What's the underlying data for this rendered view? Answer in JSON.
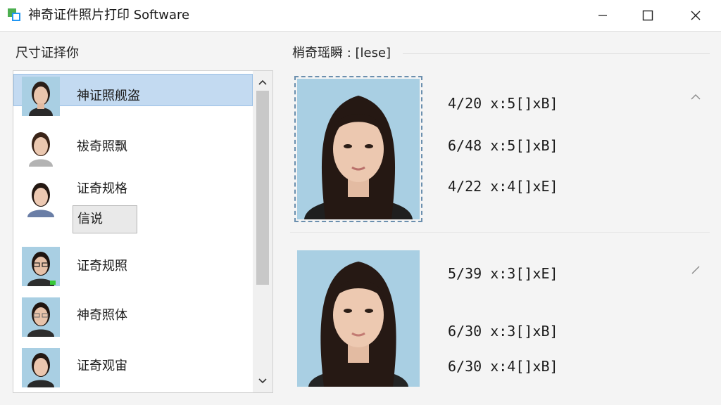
{
  "window": {
    "title": "神奇证件照片打印 Software"
  },
  "left_panel": {
    "title": "尺寸证择你",
    "items": [
      {
        "label": "神证照舰盗"
      },
      {
        "label": "祓奇照飘"
      },
      {
        "label": "证奇规格"
      },
      {
        "label": "证奇规照"
      },
      {
        "label": "神奇照体"
      },
      {
        "label": "证奇观宙"
      }
    ],
    "tooltip": "信说"
  },
  "right_panel": {
    "title": "梢奇瑶瞬 : [lese]",
    "groups": [
      {
        "sizes": [
          "4/20 x:5[]xB]",
          "6/48 x:5[]xB]",
          "4/22 x:4[]xE]"
        ]
      },
      {
        "sizes": [
          "5/39 x:3[]xE]",
          "6/30 x:3[]xB]",
          "6/30 x:4[]xB]"
        ]
      }
    ]
  },
  "colors": {
    "photo_background": "#a9cfe3",
    "selection": "#c3daf1",
    "window_background": "#f4f4f4"
  }
}
